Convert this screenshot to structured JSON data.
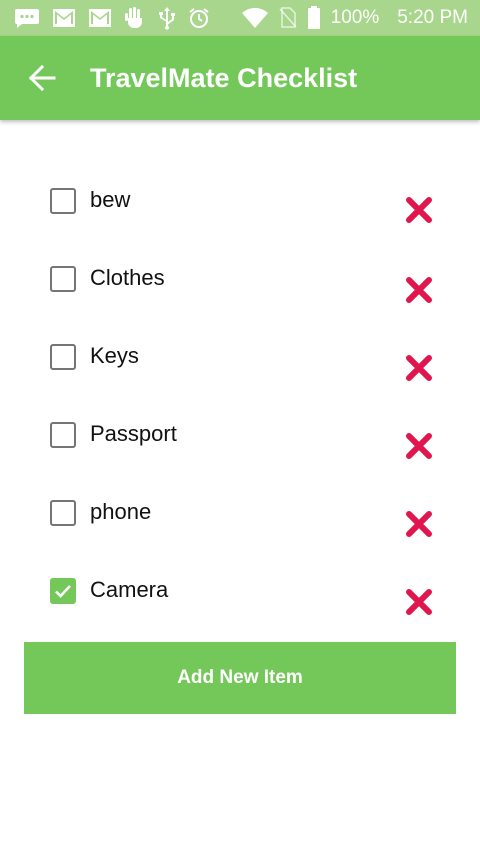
{
  "status_bar": {
    "battery": "100%",
    "time": "5:20 PM",
    "icons": [
      "message-icon",
      "gmail-icon",
      "gmail-icon",
      "gesture-icon",
      "usb-icon",
      "alarm-icon",
      "wifi-icon",
      "no-sim-icon",
      "battery-icon"
    ]
  },
  "app_bar": {
    "title": "TravelMate Checklist",
    "back_icon": "arrow-left-icon"
  },
  "items": [
    {
      "label": "bew",
      "checked": false
    },
    {
      "label": "Clothes",
      "checked": false
    },
    {
      "label": "Keys",
      "checked": false
    },
    {
      "label": "Passport",
      "checked": false
    },
    {
      "label": "phone",
      "checked": false
    },
    {
      "label": "Camera",
      "checked": true
    }
  ],
  "add_button": {
    "label": "Add New Item"
  },
  "colors": {
    "primary": "#74c85a",
    "status_bar": "#a8d68d",
    "delete": "#e0174f"
  }
}
